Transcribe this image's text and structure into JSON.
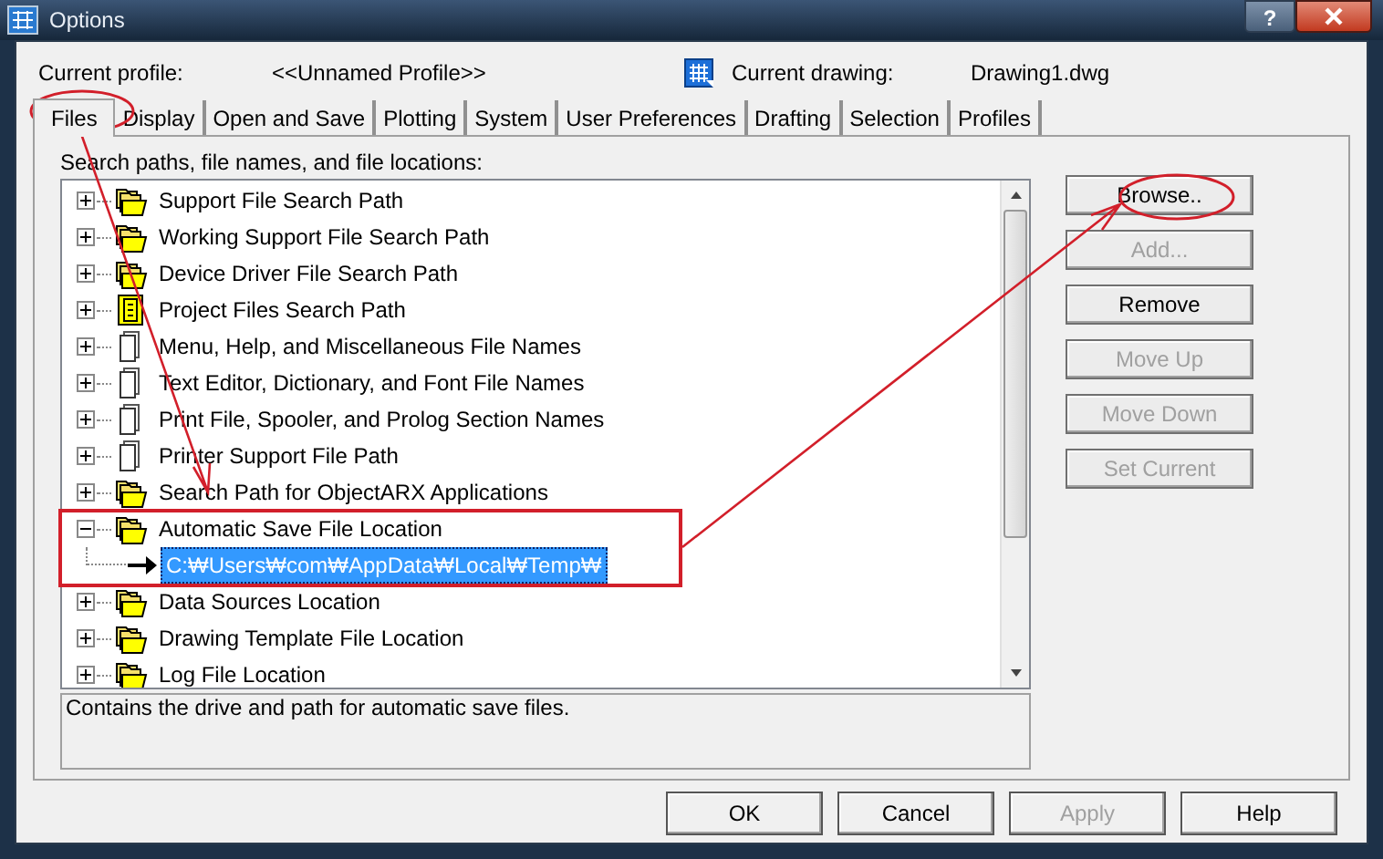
{
  "window": {
    "title": "Options",
    "help_button": "?"
  },
  "profile": {
    "label": "Current profile:",
    "value": "<<Unnamed Profile>>",
    "drawing_label": "Current drawing:",
    "drawing_value": "Drawing1.dwg"
  },
  "tabs": [
    {
      "label": "Files",
      "selected": true
    },
    {
      "label": "Display",
      "selected": false
    },
    {
      "label": "Open and Save",
      "selected": false
    },
    {
      "label": "Plotting",
      "selected": false
    },
    {
      "label": "System",
      "selected": false
    },
    {
      "label": "User Preferences",
      "selected": false
    },
    {
      "label": "Drafting",
      "selected": false
    },
    {
      "label": "Selection",
      "selected": false
    },
    {
      "label": "Profiles",
      "selected": false
    }
  ],
  "tree_label": "Search paths, file names, and file locations:",
  "tree": [
    {
      "label": "Support File Search Path",
      "kind": "folders",
      "expanded": false
    },
    {
      "label": "Working Support File Search Path",
      "kind": "folders",
      "expanded": false
    },
    {
      "label": "Device Driver File Search Path",
      "kind": "folders",
      "expanded": false
    },
    {
      "label": "Project Files Search Path",
      "kind": "project",
      "expanded": false
    },
    {
      "label": "Menu, Help, and Miscellaneous File Names",
      "kind": "files",
      "expanded": false
    },
    {
      "label": "Text Editor, Dictionary, and Font File Names",
      "kind": "files",
      "expanded": false
    },
    {
      "label": "Print File, Spooler, and Prolog Section Names",
      "kind": "files",
      "expanded": false
    },
    {
      "label": "Printer Support File Path",
      "kind": "files",
      "expanded": false
    },
    {
      "label": "Search Path for ObjectARX Applications",
      "kind": "folders",
      "expanded": false
    },
    {
      "label": "Automatic Save File Location",
      "kind": "folders",
      "expanded": true,
      "children": [
        {
          "label": "C:₩Users₩com₩AppData₩Local₩Temp₩",
          "kind": "path",
          "selected": true
        }
      ]
    },
    {
      "label": "Data Sources Location",
      "kind": "folders",
      "expanded": false
    },
    {
      "label": "Drawing Template File Location",
      "kind": "folders",
      "expanded": false
    },
    {
      "label": "Log File Location",
      "kind": "folders",
      "expanded": false
    }
  ],
  "description": "Contains the drive and path for automatic save files.",
  "side_buttons": [
    {
      "label": "Browse..",
      "disabled": false
    },
    {
      "label": "Add...",
      "disabled": true
    },
    {
      "label": "Remove",
      "disabled": false
    },
    {
      "label": "Move Up",
      "disabled": true
    },
    {
      "label": "Move Down",
      "disabled": true
    },
    {
      "label": "Set Current",
      "disabled": true
    }
  ],
  "buttons": [
    {
      "label": "OK",
      "disabled": false
    },
    {
      "label": "Cancel",
      "disabled": false
    },
    {
      "label": "Apply",
      "disabled": true
    },
    {
      "label": "Help",
      "disabled": false
    }
  ]
}
